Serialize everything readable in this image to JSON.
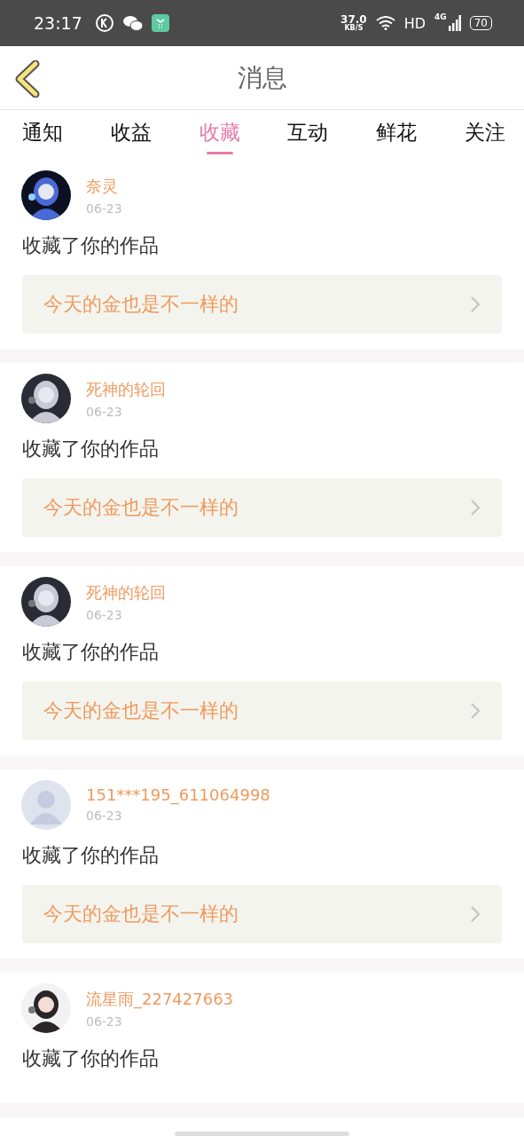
{
  "status_bar": {
    "time": "23:17",
    "speed": "37.0",
    "speed_unit": "KB/S",
    "hd": "HD",
    "network": "4G",
    "battery": "70"
  },
  "header": {
    "title": "消息"
  },
  "tabs": [
    {
      "label": "通知",
      "selected": false
    },
    {
      "label": "收益",
      "selected": false
    },
    {
      "label": "收藏",
      "selected": true
    },
    {
      "label": "互动",
      "selected": false
    },
    {
      "label": "鲜花",
      "selected": false
    },
    {
      "label": "关注",
      "selected": false
    }
  ],
  "messages": [
    {
      "name": "奈灵",
      "date": "06-23",
      "text": "收藏了你的作品",
      "work": "今天的金也是不一样的"
    },
    {
      "name": "死神的轮回",
      "date": "06-23",
      "text": "收藏了你的作品",
      "work": "今天的金也是不一样的"
    },
    {
      "name": "死神的轮回",
      "date": "06-23",
      "text": "收藏了你的作品",
      "work": "今天的金也是不一样的"
    },
    {
      "avatar": {
        "kind": "default"
      },
      "name": "151***195_611064998",
      "date": "06-23",
      "text": "收藏了你的作品",
      "work": "今天的金也是不一样的"
    },
    {
      "name": "流星雨_227427663",
      "date": "06-23",
      "text": "收藏了你的作品"
    }
  ]
}
